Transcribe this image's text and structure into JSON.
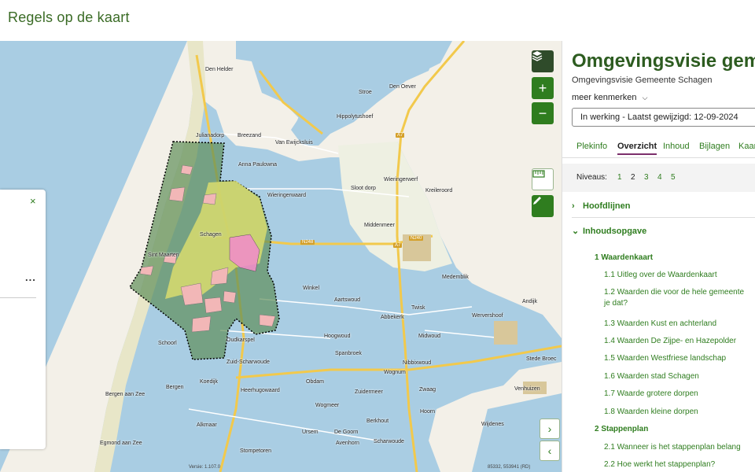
{
  "header": {
    "title": "Regels op de kaart"
  },
  "map": {
    "places": [
      {
        "name": "Den Helder"
      },
      {
        "name": "Stroe"
      },
      {
        "name": "Den Oever"
      },
      {
        "name": "Hippolytushoef"
      },
      {
        "name": "Julianadorp"
      },
      {
        "name": "Breezand"
      },
      {
        "name": "Van Ewijcksluis"
      },
      {
        "name": "Anna Paulowna"
      },
      {
        "name": "Wieringerwaard"
      },
      {
        "name": "Sloot dorp"
      },
      {
        "name": "Wieringerwerf"
      },
      {
        "name": "Kreileroord"
      },
      {
        "name": "Middenmeer"
      },
      {
        "name": "Schagen"
      },
      {
        "name": "Sint Maarten"
      },
      {
        "name": "Winkel"
      },
      {
        "name": "Medemblik"
      },
      {
        "name": "Aartswoud"
      },
      {
        "name": "Andijk"
      },
      {
        "name": "Twisk"
      },
      {
        "name": "Abbekerk"
      },
      {
        "name": "Wervershoof"
      },
      {
        "name": "Oudkarspel"
      },
      {
        "name": "Hoogwoud"
      },
      {
        "name": "Midwoud"
      },
      {
        "name": "Schoorl"
      },
      {
        "name": "Zuid-Scharwoude"
      },
      {
        "name": "Spanbroek"
      },
      {
        "name": "Nibbixwoud"
      },
      {
        "name": "Stede Broec"
      },
      {
        "name": "Wognum"
      },
      {
        "name": "Koedijk"
      },
      {
        "name": "Obdam"
      },
      {
        "name": "Bergen"
      },
      {
        "name": "Bergen aan Zee"
      },
      {
        "name": "Heerhugowaard"
      },
      {
        "name": "Zuidermeer"
      },
      {
        "name": "Zwaag"
      },
      {
        "name": "Venhuizen"
      },
      {
        "name": "Wogmeer"
      },
      {
        "name": "Hoorn"
      },
      {
        "name": "Berkhout"
      },
      {
        "name": "Alkmaar"
      },
      {
        "name": "Wijdenes"
      },
      {
        "name": "Egmond aan Zee"
      },
      {
        "name": "Ursem"
      },
      {
        "name": "De Goorn"
      },
      {
        "name": "Scharwoude"
      },
      {
        "name": "Avenhorn"
      },
      {
        "name": "Stompetoren"
      }
    ],
    "roads": [
      "A7",
      "N240",
      "N248",
      "A7"
    ],
    "version": "Versie: 1.107.0",
    "coords": "85332, 553941 (RD)"
  },
  "left_panel": {
    "close": "×",
    "more": "..."
  },
  "right_panel": {
    "title": "Omgevingsvisie gemeen",
    "subtitle": "Omgevingsvisie  Gemeente Schagen",
    "meer": "meer kenmerken",
    "status": "In werking - Laatst gewijzigd: 12-09-2024",
    "tabs": [
      "Plekinfo",
      "Overzicht",
      "Inhoud",
      "Bijlagen",
      "Kaart"
    ],
    "active_tab": "Overzicht",
    "levels_label": "Niveaus:",
    "levels": [
      "1",
      "2",
      "3",
      "4",
      "5"
    ],
    "current_level": "2",
    "sections": {
      "hoofdlijnen": "Hoofdlijnen",
      "inhoudsopgave": "Inhoudsopgave"
    },
    "toc": [
      {
        "type": "h",
        "text": "1 Waardenkaart"
      },
      {
        "type": "i",
        "text": "1.1 Uitleg over de Waardenkaart"
      },
      {
        "type": "i",
        "text": "1.2 Waarden die voor de hele gemeente"
      },
      {
        "type": "c",
        "text": "je dat?"
      },
      {
        "type": "i",
        "text": "1.3 Waarden Kust en achterland"
      },
      {
        "type": "i",
        "text": "1.4 Waarden De Zijpe- en Hazepolder"
      },
      {
        "type": "i",
        "text": "1.5 Waarden Westfriese landschap"
      },
      {
        "type": "i",
        "text": "1.6 Waarden stad Schagen"
      },
      {
        "type": "i",
        "text": "1.7 Waarde grotere dorpen"
      },
      {
        "type": "i",
        "text": "1.8 Waarden kleine dorpen"
      },
      {
        "type": "h",
        "text": "2 Stappenplan"
      },
      {
        "type": "i",
        "text": "2.1 Wanneer is het stappenplan belang"
      },
      {
        "type": "i",
        "text": "2.2 Hoe werkt het stappenplan?"
      }
    ]
  },
  "colors": {
    "brand_green": "#2f7d1f",
    "title_green": "#2d5c20",
    "tab_underline": "#7b2f6b"
  }
}
